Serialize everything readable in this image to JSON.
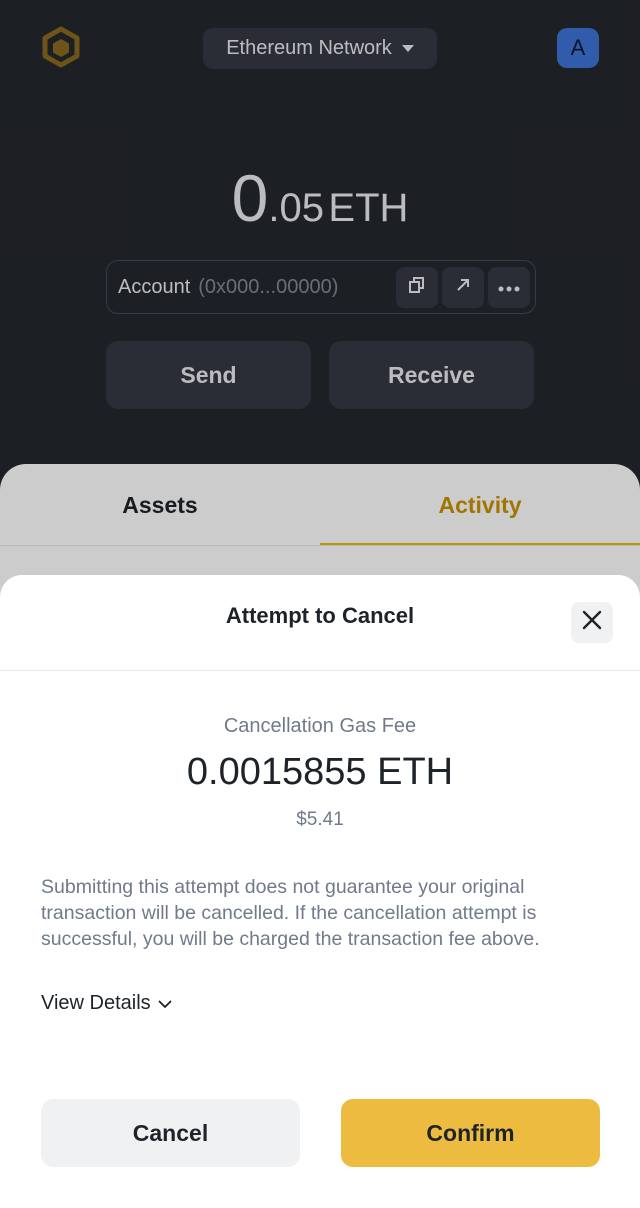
{
  "header": {
    "logo_icon": "binance-logo-icon",
    "network": "Ethereum Network",
    "avatar_letter": "A"
  },
  "balance": {
    "integer": "0",
    "decimal": ".05",
    "unit": "ETH"
  },
  "account": {
    "label": "Account",
    "address": "(0x000...00000)",
    "actions": [
      "copy-icon",
      "open-external-icon",
      "more-icon"
    ]
  },
  "actions": {
    "send": "Send",
    "receive": "Receive"
  },
  "tabs": {
    "assets": "Assets",
    "activity": "Activity",
    "selected": "Activity"
  },
  "sheet": {
    "title": "Attempt to Cancel",
    "fee_label": "Cancellation Gas Fee",
    "fee_amount": "0.0015855 ETH",
    "fee_usd": "$5.41",
    "disclaimer": "Submitting this attempt does not guarantee your original transaction will be cancelled. If the cancellation attempt is successful, you will be charged the transaction fee above.",
    "view_details": "View Details",
    "cancel_label": "Cancel",
    "confirm_label": "Confirm"
  },
  "colors": {
    "brand": "#f0b90b",
    "confirm": "#ecbb3f",
    "dark_bg": "#24272e",
    "avatar": "#3e74d6"
  }
}
